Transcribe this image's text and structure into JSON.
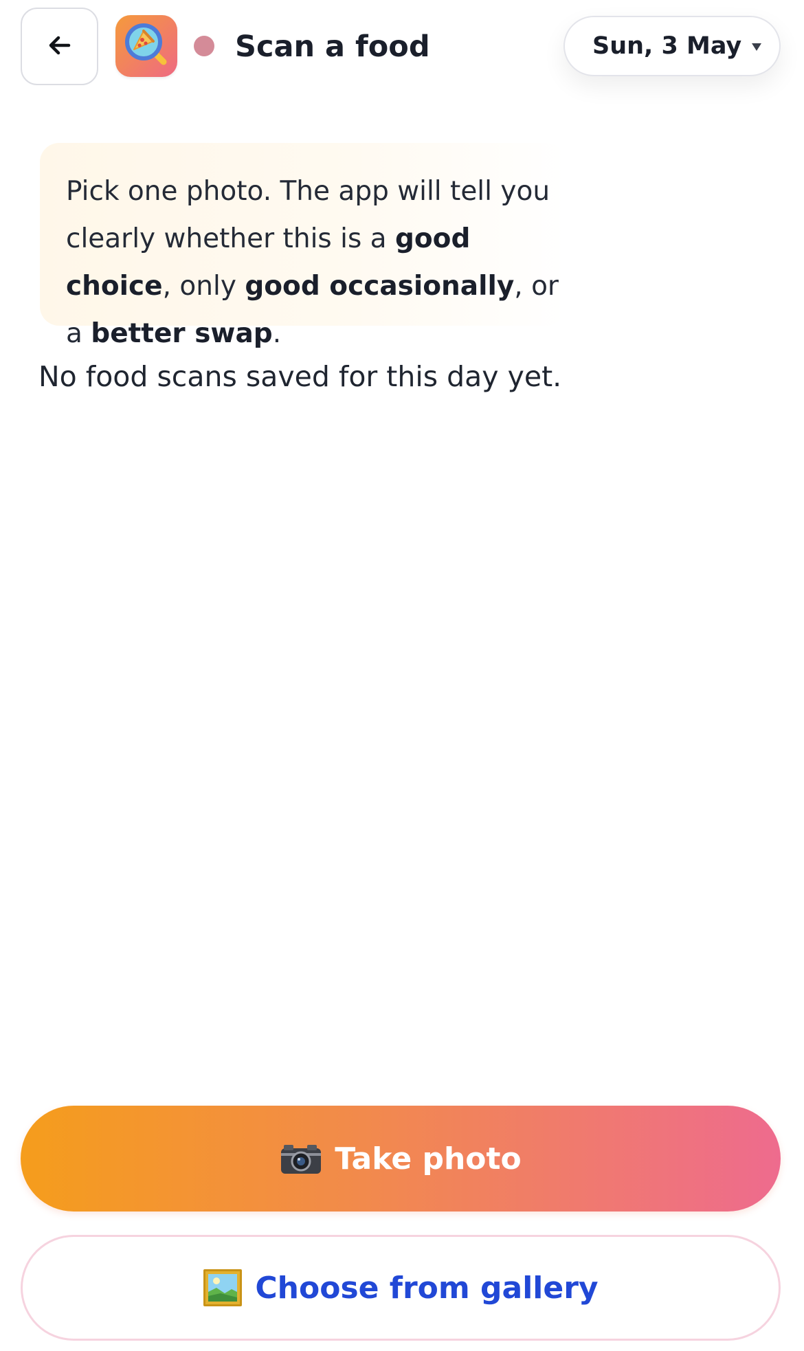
{
  "header": {
    "back_icon": "arrow-left-icon",
    "app_icon": "pizza-magnifier-icon",
    "title": "Scan a food",
    "status_dot_color": "#d48b98",
    "date_picker": {
      "label": "Sun, 3 May",
      "icon": "chevron-down-icon"
    }
  },
  "info_card": {
    "parts": {
      "p1": "Pick one photo. The app will tell you clearly whether this is a ",
      "b1": "good choice",
      "p2": ", only ",
      "b2": "good occasionally",
      "p3": ", or a ",
      "b3": "better swap",
      "p4": "."
    }
  },
  "empty_state": {
    "message": "No food scans saved for this day yet."
  },
  "actions": {
    "take_photo": {
      "icon": "camera-icon",
      "label": "Take photo"
    },
    "gallery": {
      "icon": "framed-picture-icon",
      "label": "Choose from gallery"
    }
  },
  "colors": {
    "primary_gradient_start": "#f59d1c",
    "primary_gradient_end": "#ee6b8e",
    "link_blue": "#2148d6",
    "info_card_bg": "#fff7e9"
  }
}
